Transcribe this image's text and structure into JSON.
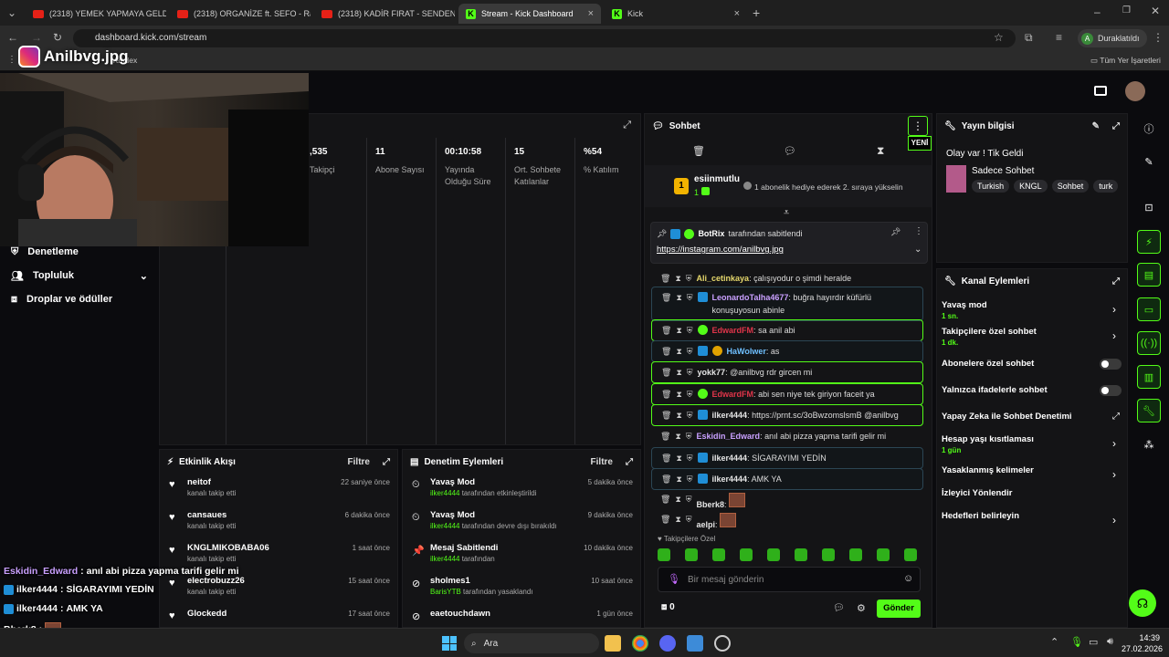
{
  "tabs": [
    {
      "label": "(2318) YEMEK YAPMAYA GELDİ...",
      "kind": "yt"
    },
    {
      "label": "(2318) ORGANİZE ft. SEFO - Ra...",
      "kind": "yt"
    },
    {
      "label": "(2318) KADİR FIRAT - SENDEN ...",
      "kind": "yt"
    },
    {
      "label": "Stream - Kick Dashboard",
      "kind": "kick"
    },
    {
      "label": "Kick",
      "kind": "kick"
    }
  ],
  "browser": {
    "url": "dashboard.kick.com/stream",
    "profile_label": "Duraklatıldı",
    "bookmark_yandex": "Yandex",
    "bookmarks_all": "Tüm Yer İşaretleri"
  },
  "overlay": {
    "brand": "Anilbvg.jpg",
    "chat": [
      {
        "user": "Eskidin_Edward",
        "text": "anıl abi pizza yapma tarifi gelir mi",
        "color": "#c9a0ff",
        "badge": false
      },
      {
        "user": "ilker4444",
        "text": "SİGARAYIMI YEDİN",
        "color": "#ffffff",
        "badge": true
      },
      {
        "user": "ilker4444",
        "text": "AMK YA",
        "color": "#ffffff",
        "badge": true
      },
      {
        "user": "Bberk8",
        "text": "",
        "color": "#ffffff",
        "badge": false
      },
      {
        "user": "aelpi",
        "text": "",
        "color": "#ffffff",
        "badge": false
      }
    ]
  },
  "leftnav": {
    "moderation": "Denetleme",
    "community": "Topluluk",
    "drops": "Droplar ve ödüller"
  },
  "stats": [
    {
      "value": ",535",
      "label": "Takipçi"
    },
    {
      "value": "11",
      "label": "Abone Sayısı"
    },
    {
      "value": "00:10:58",
      "label": "Yayında Olduğu Süre"
    },
    {
      "value": "15",
      "label": "Ort. Sohbete Katılanlar"
    },
    {
      "value": "%54",
      "label": "% Katılım"
    }
  ],
  "activity": {
    "title": "Etkinlik Akışı",
    "filter": "Filtre",
    "items": [
      {
        "name": "neitof",
        "sub": "kanalı takip etti",
        "time": "22 saniye önce"
      },
      {
        "name": "cansaues",
        "sub": "kanalı takip etti",
        "time": "6 dakika önce"
      },
      {
        "name": "KNGLMIKOBABA06",
        "sub": "kanalı takip etti",
        "time": "1 saat önce"
      },
      {
        "name": "electrobuzz26",
        "sub": "kanalı takip etti",
        "time": "15 saat önce"
      },
      {
        "name": "Glockedd",
        "sub": "",
        "time": "17 saat önce"
      }
    ]
  },
  "modactions": {
    "title": "Denetim Eylemleri",
    "filter": "Filtre",
    "items": [
      {
        "name": "Yavaş Mod",
        "user": "ilker4444",
        "rest": "tarafından etkinleştirildi",
        "time": "5 dakika önce",
        "icon": "⏲"
      },
      {
        "name": "Yavaş Mod",
        "user": "ilker4444",
        "rest": "tarafından devre dışı bırakıldı",
        "time": "9 dakika önce",
        "icon": "⏲"
      },
      {
        "name": "Mesaj Sabitlendi",
        "user": "ilker4444",
        "rest": "tarafından",
        "time": "10 dakika önce",
        "icon": "📌"
      },
      {
        "name": "sholmes1",
        "user": "BarisYTB",
        "rest": "tarafından yasaklandı",
        "time": "10 saat önce",
        "icon": "⊘"
      },
      {
        "name": "eaetouchdawn",
        "user": "",
        "rest": "",
        "time": "1 gün önce",
        "icon": "⊘"
      }
    ]
  },
  "chat": {
    "title": "Sohbet",
    "new_label": "YENİ",
    "gift": {
      "user": "esiinmutlu",
      "count": "1",
      "text": "1 abonelik hediye ederek 2. sıraya yükselin"
    },
    "pinned": {
      "by": "BotRix",
      "by_suffix": "tarafından sabitlendi",
      "link": "https://instagram.com/anilbvg.jpg"
    },
    "messages": [
      {
        "user": "Ali_cetinkaya",
        "text": "çalışıyodur o şimdi heralde",
        "color": "#e6d86c",
        "style": "none",
        "badges": []
      },
      {
        "user": "LeonardoTalha4677",
        "text": "buğra hayırdır küfürlü konuşuyosun abinle",
        "color": "#c9a0ff",
        "style": "blue",
        "badges": [
          "k"
        ]
      },
      {
        "user": "EdwardFM",
        "text": "sa anil abi",
        "color": "#e0354a",
        "style": "green",
        "badges": [
          "v"
        ]
      },
      {
        "user": "HaWolwer",
        "text": "as",
        "color": "#6fc0ff",
        "style": "blue",
        "badges": [
          "k",
          "o"
        ]
      },
      {
        "user": "yokk77",
        "text": "@anilbvg rdr gircen mi",
        "color": "#e6e6e6",
        "style": "green",
        "badges": []
      },
      {
        "user": "EdwardFM",
        "text": "abi sen niye tek giriyon faceit ya",
        "color": "#e0354a",
        "style": "green",
        "badges": [
          "v"
        ]
      },
      {
        "user": "ilker4444",
        "text": "https://prnt.sc/3oBwzomslsmB @anilbvg",
        "color": "#e6e6e6",
        "style": "green",
        "badges": [
          "k"
        ]
      },
      {
        "user": "Eskidin_Edward",
        "text": "anıl abi pizza yapma tarifi gelir mi",
        "color": "#c9a0ff",
        "style": "none",
        "badges": []
      },
      {
        "user": "ilker4444",
        "text": "SİGARAYIMI YEDİN",
        "color": "#e6e6e6",
        "style": "blue",
        "badges": [
          "k"
        ]
      },
      {
        "user": "ilker4444",
        "text": "AMK YA",
        "color": "#e6e6e6",
        "style": "blue",
        "badges": [
          "k"
        ]
      },
      {
        "user": "Bberk8",
        "text": "",
        "color": "#e6e6e6",
        "style": "none",
        "badges": []
      },
      {
        "user": "aelpi",
        "text": "",
        "color": "#e6e6e6",
        "style": "none",
        "badges": []
      }
    ],
    "followers_only": "Takipçilere Özel",
    "placeholder": "Bir mesaj gönderin",
    "points": "0",
    "send": "Gönder"
  },
  "streaminfo": {
    "title": "Yayın bilgisi",
    "stream_title": "Olay var ! Tik Geldi",
    "category": "Sadece Sohbet",
    "tags": [
      "Turkish",
      "KNGL",
      "Sohbet",
      "turk"
    ]
  },
  "channel_actions": {
    "title": "Kanal Eylemleri",
    "items": [
      {
        "label": "Yavaş mod",
        "sub": "1 sn.",
        "control": "chevron"
      },
      {
        "label": "Takipçilere özel sohbet",
        "sub": "1 dk.",
        "control": "chevron"
      },
      {
        "label": "Abonelere özel sohbet",
        "sub": "",
        "control": "toggle"
      },
      {
        "label": "Yalnızca ifadelerle sohbet",
        "sub": "",
        "control": "toggle"
      },
      {
        "label": "Yapay Zeka ile Sohbet Denetimi",
        "sub": "",
        "control": "external"
      },
      {
        "label": "Hesap yaşı kısıtlaması",
        "sub": "1 gün",
        "control": "chevron"
      },
      {
        "label": "Yasaklanmış kelimeler",
        "sub": "",
        "control": "chevron"
      },
      {
        "label": "İzleyici Yönlendir",
        "sub": "",
        "control": "none"
      },
      {
        "label": "Hedefleri belirleyin",
        "sub": "",
        "control": "chevron"
      }
    ]
  },
  "taskbar": {
    "search": "Ara",
    "time": "14:39",
    "date": "27.02.2026"
  }
}
